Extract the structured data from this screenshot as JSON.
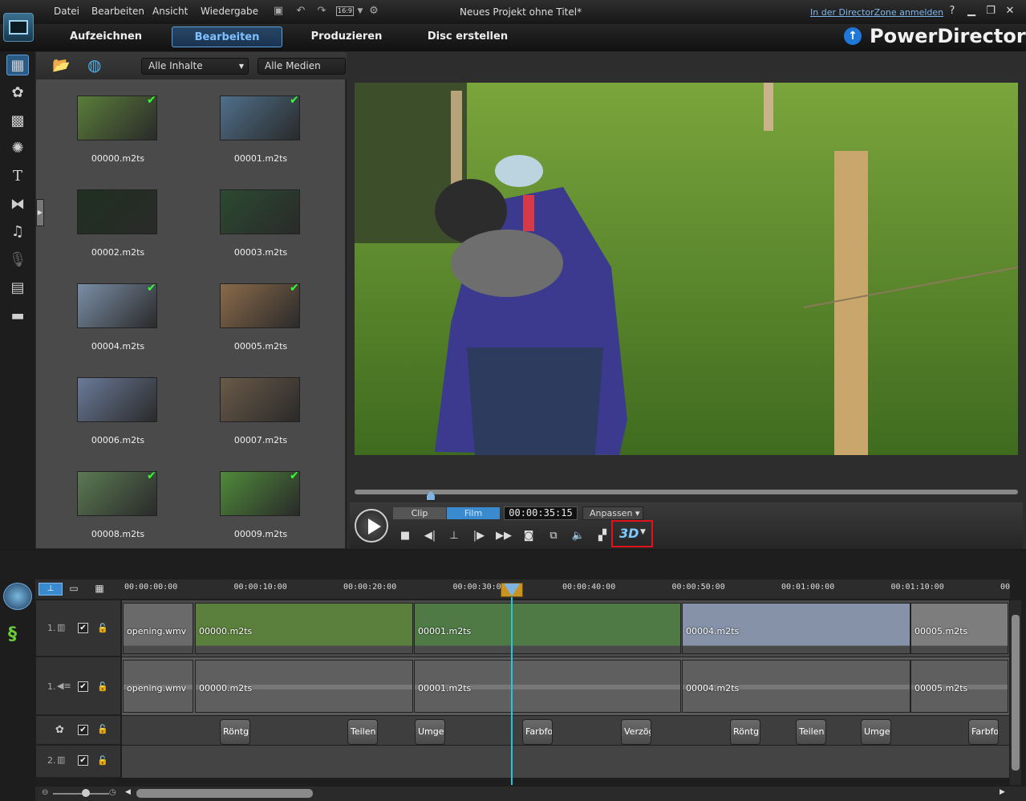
{
  "menu": [
    "Datei",
    "Bearbeiten",
    "Ansicht",
    "Wiedergabe"
  ],
  "window_title": "Neues Projekt ohne Titel*",
  "login_link": "In der DirectorZone anmelden",
  "aspect": "16:9",
  "modes": [
    {
      "label": "Aufzeichnen"
    },
    {
      "label": "Bearbeiten"
    },
    {
      "label": "Produzieren"
    },
    {
      "label": "Disc erstellen"
    }
  ],
  "brand": "PowerDirector",
  "library": {
    "filter1": "Alle Inhalte",
    "filter2": "Alle Medien",
    "items": [
      {
        "name": "00000.m2ts",
        "checked": true,
        "color": "#5a7d3a"
      },
      {
        "name": "00001.m2ts",
        "checked": true,
        "color": "#4f6f8a"
      },
      {
        "name": "00002.m2ts",
        "checked": false,
        "color": "#1f3020"
      },
      {
        "name": "00003.m2ts",
        "checked": false,
        "color": "#2b4a30"
      },
      {
        "name": "00004.m2ts",
        "checked": true,
        "color": "#7a8ea6"
      },
      {
        "name": "00005.m2ts",
        "checked": true,
        "color": "#8a6a4a"
      },
      {
        "name": "00006.m2ts",
        "checked": false,
        "color": "#6a7a99"
      },
      {
        "name": "00007.m2ts",
        "checked": false,
        "color": "#6b5a48"
      },
      {
        "name": "00008.m2ts",
        "checked": true,
        "color": "#5b7a52"
      },
      {
        "name": "00009.m2ts",
        "checked": true,
        "color": "#4f8a3a"
      }
    ]
  },
  "player": {
    "clip_tab": "Clip",
    "film_tab": "Film",
    "timecode": "00:00:35:15",
    "fit": "Anpassen",
    "threed": "3D"
  },
  "timeline": {
    "ticks": [
      "00:00:00:00",
      "00:00:10:00",
      "00:00:20:00",
      "00:00:30:00",
      "00:00:40:00",
      "00:00:50:00",
      "00:01:00:00",
      "00:01:10:00",
      "00"
    ],
    "track1_label": "1.",
    "track2_label": "2.",
    "video_clips": [
      "opening.wmv",
      "00000.m2ts",
      "00001.m2ts",
      "00004.m2ts",
      "00005.m2ts"
    ],
    "audio_clips": [
      "opening.wmv",
      "00000.m2ts",
      "00001.m2ts",
      "00004.m2ts",
      "00005.m2ts"
    ],
    "fx_clips": [
      "Röntg",
      "Teilen",
      "Umge",
      "Farbfo",
      "Verzög",
      "Röntg",
      "Teilen",
      "Umgel",
      "Farbfo"
    ]
  }
}
